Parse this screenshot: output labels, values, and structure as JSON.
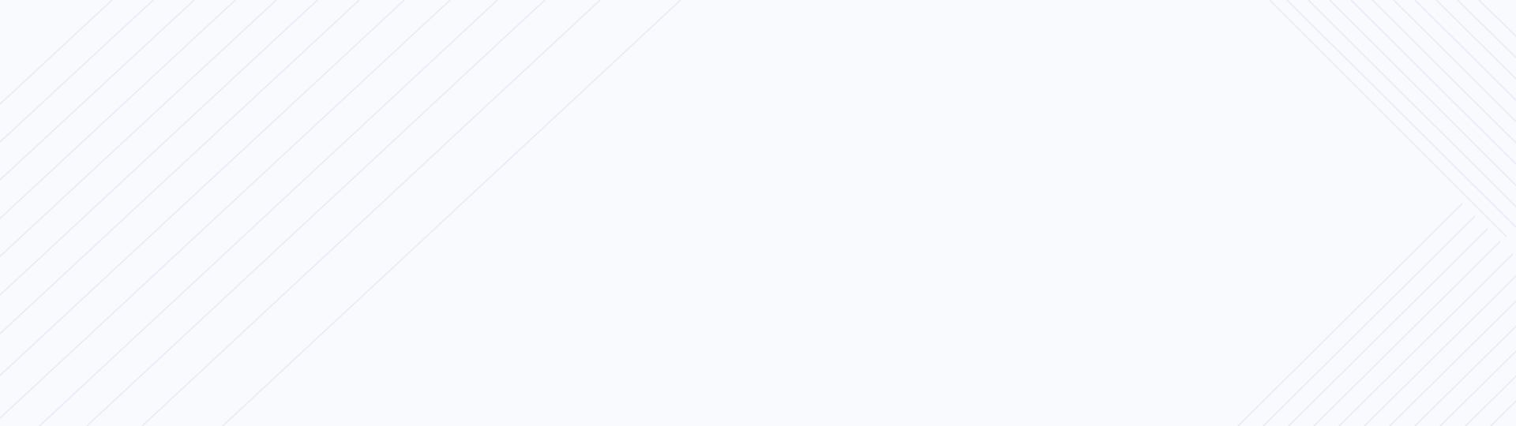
{
  "background": {
    "color": "#F9FAFE",
    "line_color": "#E7EBF7"
  }
}
